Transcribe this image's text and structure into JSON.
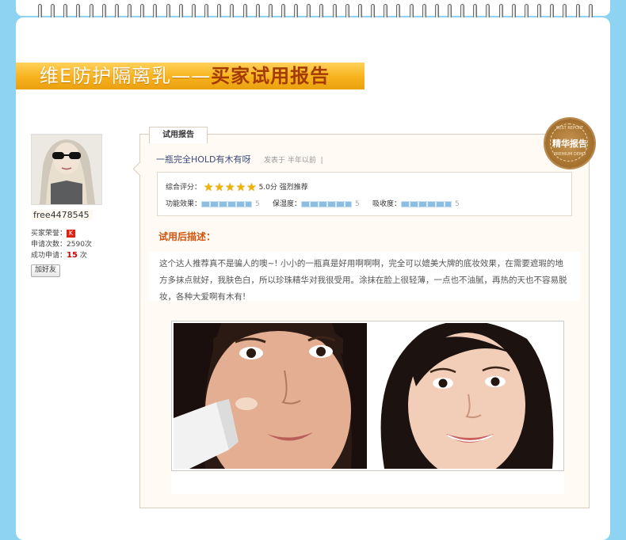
{
  "page": {
    "title_plain": "维E防护隔离乳——",
    "title_highlight": "买家试用报告"
  },
  "user": {
    "username": "free4478545",
    "honor_label": "买家荣誉：",
    "honor_badge": "K",
    "apply_count_label": "申请次数：",
    "apply_count": "2590次",
    "success_label": "成功申请：",
    "success_count": "15",
    "success_unit": " 次",
    "add_friend": "加好友"
  },
  "report": {
    "tab_label": "试用报告",
    "seal_top": "BEST REPORT",
    "seal_main": "精华报告",
    "seal_bottom": "PREMIUM DEMO",
    "title": "一瓶完全HOLD有木有呀",
    "posted": "发表于 半年以前",
    "posted_sep": "|",
    "overall_label": "综合评分：",
    "overall_score": "5.0分",
    "overall_text": "强烈推荐",
    "rating": 5,
    "metrics": [
      {
        "label": "功能效果：",
        "value": "5"
      },
      {
        "label": "保湿度：",
        "value": "5"
      },
      {
        "label": "吸收度：",
        "value": "5"
      }
    ],
    "desc_heading": "试用后描述：",
    "description": "这个达人推荐真不是骗人的噢~! 小小的一瓶真是好用啊啊啊，完全可以媲美大牌的底妆效果，在需要遮瑕的地方多抹点就好，我肤色白，所以珍珠精华对我很受用。涂抹在脸上很轻薄，一点也不油腻，再热的天也不容易脱妆，各种大爱啊有木有!"
  },
  "colors": {
    "background": "#8fd3f2",
    "banner": "#f7b21d",
    "accent": "#d2530c",
    "link": "#3a4a7a"
  }
}
